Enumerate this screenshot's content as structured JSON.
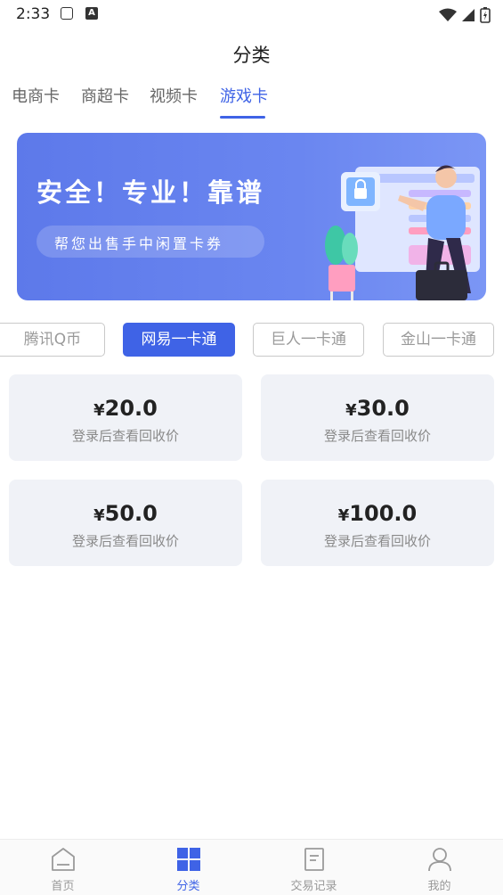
{
  "status_bar": {
    "time": "2:33",
    "badge_letter": "A"
  },
  "header": {
    "title": "分类"
  },
  "category_tabs": [
    {
      "label": "电商卡",
      "active": false
    },
    {
      "label": "商超卡",
      "active": false
    },
    {
      "label": "视频卡",
      "active": false
    },
    {
      "label": "游戏卡",
      "active": true
    }
  ],
  "banner": {
    "headline": "安全！专业！靠谱",
    "subtitle": "帮您出售手中闲置卡券"
  },
  "platform_tabs": [
    {
      "label": "腾讯Q币",
      "active": false
    },
    {
      "label": "网易一卡通",
      "active": true
    },
    {
      "label": "巨人一卡通",
      "active": false
    },
    {
      "label": "金山一卡通",
      "active": false
    }
  ],
  "cards": [
    {
      "currency": "¥",
      "amount": "20.0",
      "note": "登录后查看回收价"
    },
    {
      "currency": "¥",
      "amount": "30.0",
      "note": "登录后查看回收价"
    },
    {
      "currency": "¥",
      "amount": "50.0",
      "note": "登录后查看回收价"
    },
    {
      "currency": "¥",
      "amount": "100.0",
      "note": "登录后查看回收价"
    }
  ],
  "bottom_nav": [
    {
      "label": "首页",
      "icon": "home-icon",
      "active": false
    },
    {
      "label": "分类",
      "icon": "grid-icon",
      "active": true
    },
    {
      "label": "交易记录",
      "icon": "record-icon",
      "active": false
    },
    {
      "label": "我的",
      "icon": "user-icon",
      "active": false
    }
  ],
  "colors": {
    "accent": "#3f63e6",
    "card_bg": "#f0f2f7",
    "banner": "#6a86f0"
  }
}
